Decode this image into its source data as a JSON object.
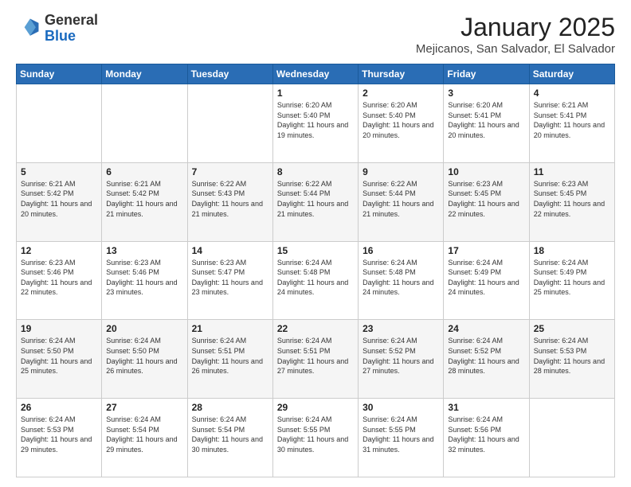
{
  "logo": {
    "general": "General",
    "blue": "Blue"
  },
  "header": {
    "month": "January 2025",
    "location": "Mejicanos, San Salvador, El Salvador"
  },
  "days_of_week": [
    "Sunday",
    "Monday",
    "Tuesday",
    "Wednesday",
    "Thursday",
    "Friday",
    "Saturday"
  ],
  "weeks": [
    [
      {
        "day": "",
        "info": ""
      },
      {
        "day": "",
        "info": ""
      },
      {
        "day": "",
        "info": ""
      },
      {
        "day": "1",
        "info": "Sunrise: 6:20 AM\nSunset: 5:40 PM\nDaylight: 11 hours and 19 minutes."
      },
      {
        "day": "2",
        "info": "Sunrise: 6:20 AM\nSunset: 5:40 PM\nDaylight: 11 hours and 20 minutes."
      },
      {
        "day": "3",
        "info": "Sunrise: 6:20 AM\nSunset: 5:41 PM\nDaylight: 11 hours and 20 minutes."
      },
      {
        "day": "4",
        "info": "Sunrise: 6:21 AM\nSunset: 5:41 PM\nDaylight: 11 hours and 20 minutes."
      }
    ],
    [
      {
        "day": "5",
        "info": "Sunrise: 6:21 AM\nSunset: 5:42 PM\nDaylight: 11 hours and 20 minutes."
      },
      {
        "day": "6",
        "info": "Sunrise: 6:21 AM\nSunset: 5:42 PM\nDaylight: 11 hours and 21 minutes."
      },
      {
        "day": "7",
        "info": "Sunrise: 6:22 AM\nSunset: 5:43 PM\nDaylight: 11 hours and 21 minutes."
      },
      {
        "day": "8",
        "info": "Sunrise: 6:22 AM\nSunset: 5:44 PM\nDaylight: 11 hours and 21 minutes."
      },
      {
        "day": "9",
        "info": "Sunrise: 6:22 AM\nSunset: 5:44 PM\nDaylight: 11 hours and 21 minutes."
      },
      {
        "day": "10",
        "info": "Sunrise: 6:23 AM\nSunset: 5:45 PM\nDaylight: 11 hours and 22 minutes."
      },
      {
        "day": "11",
        "info": "Sunrise: 6:23 AM\nSunset: 5:45 PM\nDaylight: 11 hours and 22 minutes."
      }
    ],
    [
      {
        "day": "12",
        "info": "Sunrise: 6:23 AM\nSunset: 5:46 PM\nDaylight: 11 hours and 22 minutes."
      },
      {
        "day": "13",
        "info": "Sunrise: 6:23 AM\nSunset: 5:46 PM\nDaylight: 11 hours and 23 minutes."
      },
      {
        "day": "14",
        "info": "Sunrise: 6:23 AM\nSunset: 5:47 PM\nDaylight: 11 hours and 23 minutes."
      },
      {
        "day": "15",
        "info": "Sunrise: 6:24 AM\nSunset: 5:48 PM\nDaylight: 11 hours and 24 minutes."
      },
      {
        "day": "16",
        "info": "Sunrise: 6:24 AM\nSunset: 5:48 PM\nDaylight: 11 hours and 24 minutes."
      },
      {
        "day": "17",
        "info": "Sunrise: 6:24 AM\nSunset: 5:49 PM\nDaylight: 11 hours and 24 minutes."
      },
      {
        "day": "18",
        "info": "Sunrise: 6:24 AM\nSunset: 5:49 PM\nDaylight: 11 hours and 25 minutes."
      }
    ],
    [
      {
        "day": "19",
        "info": "Sunrise: 6:24 AM\nSunset: 5:50 PM\nDaylight: 11 hours and 25 minutes."
      },
      {
        "day": "20",
        "info": "Sunrise: 6:24 AM\nSunset: 5:50 PM\nDaylight: 11 hours and 26 minutes."
      },
      {
        "day": "21",
        "info": "Sunrise: 6:24 AM\nSunset: 5:51 PM\nDaylight: 11 hours and 26 minutes."
      },
      {
        "day": "22",
        "info": "Sunrise: 6:24 AM\nSunset: 5:51 PM\nDaylight: 11 hours and 27 minutes."
      },
      {
        "day": "23",
        "info": "Sunrise: 6:24 AM\nSunset: 5:52 PM\nDaylight: 11 hours and 27 minutes."
      },
      {
        "day": "24",
        "info": "Sunrise: 6:24 AM\nSunset: 5:52 PM\nDaylight: 11 hours and 28 minutes."
      },
      {
        "day": "25",
        "info": "Sunrise: 6:24 AM\nSunset: 5:53 PM\nDaylight: 11 hours and 28 minutes."
      }
    ],
    [
      {
        "day": "26",
        "info": "Sunrise: 6:24 AM\nSunset: 5:53 PM\nDaylight: 11 hours and 29 minutes."
      },
      {
        "day": "27",
        "info": "Sunrise: 6:24 AM\nSunset: 5:54 PM\nDaylight: 11 hours and 29 minutes."
      },
      {
        "day": "28",
        "info": "Sunrise: 6:24 AM\nSunset: 5:54 PM\nDaylight: 11 hours and 30 minutes."
      },
      {
        "day": "29",
        "info": "Sunrise: 6:24 AM\nSunset: 5:55 PM\nDaylight: 11 hours and 30 minutes."
      },
      {
        "day": "30",
        "info": "Sunrise: 6:24 AM\nSunset: 5:55 PM\nDaylight: 11 hours and 31 minutes."
      },
      {
        "day": "31",
        "info": "Sunrise: 6:24 AM\nSunset: 5:56 PM\nDaylight: 11 hours and 32 minutes."
      },
      {
        "day": "",
        "info": ""
      }
    ]
  ]
}
